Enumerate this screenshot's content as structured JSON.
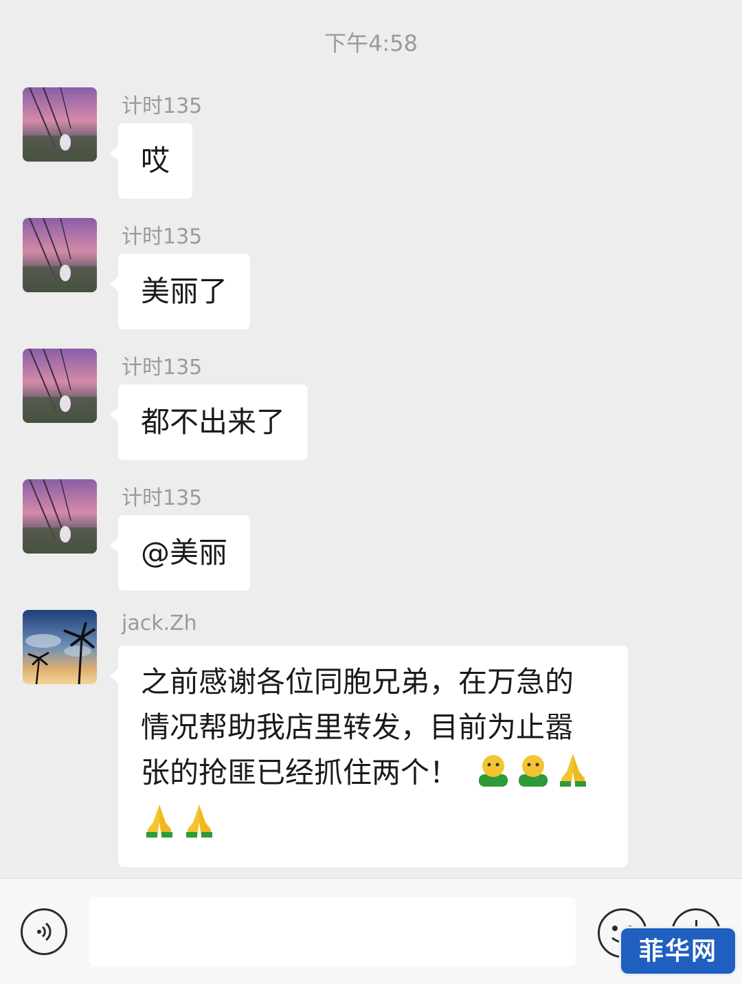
{
  "chat": {
    "timestamp": "下午4:58",
    "messages": [
      {
        "sender": "计时135",
        "text": "哎",
        "avatar_icon": "sunset-swing-avatar"
      },
      {
        "sender": "计时135",
        "text": "美丽了",
        "avatar_icon": "sunset-swing-avatar"
      },
      {
        "sender": "计时135",
        "text": "都不出来了",
        "avatar_icon": "sunset-swing-avatar"
      },
      {
        "sender": "计时135",
        "text": "@美丽",
        "avatar_icon": "sunset-swing-avatar"
      },
      {
        "sender": "jack.Zh",
        "avatar_icon": "palm-tree-avatar",
        "lines": [
          "之前感谢各位同胞兄弟，在万急的",
          "情况帮助我店里转发，目前为止嚣",
          "张的抢匪已经抓住两个！"
        ],
        "emojis": [
          "grin-emoji",
          "grin-emoji",
          "pray-emoji",
          "pray-emoji",
          "pray-emoji"
        ]
      }
    ]
  },
  "input_bar": {
    "value": "",
    "voice_icon": "voice-icon",
    "emoji_icon": "smiley-icon",
    "more_icon": "plus-icon"
  },
  "watermark": {
    "text": "菲华网"
  },
  "colors": {
    "background": "#ededed",
    "bubble": "#ffffff",
    "sender_text": "#9a9a9a",
    "watermark_bg": "#1f5fbf"
  }
}
